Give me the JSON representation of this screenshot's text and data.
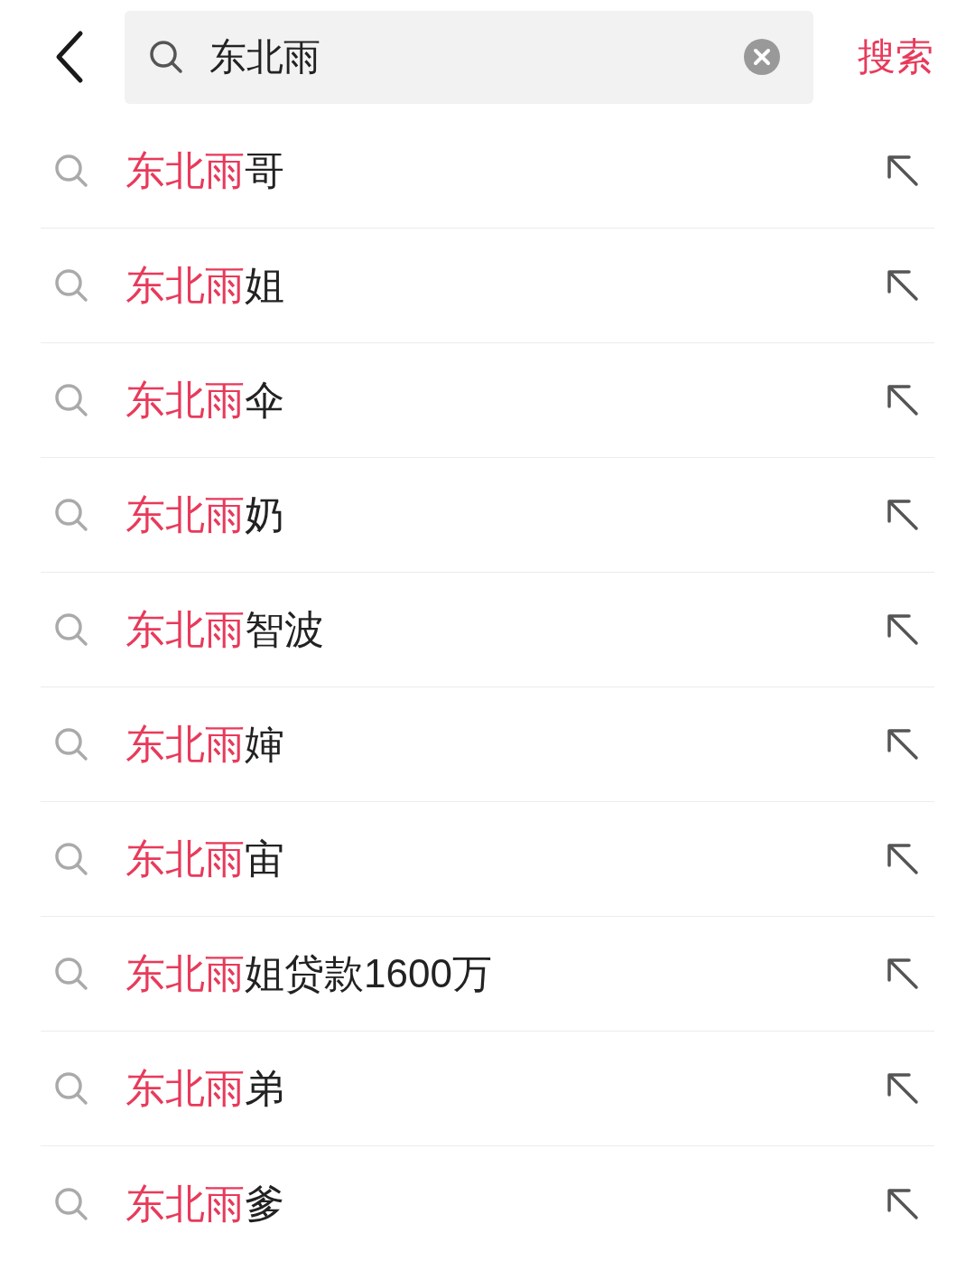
{
  "search": {
    "value": "东北雨",
    "button": "搜索"
  },
  "suggestions": [
    {
      "highlight": "东北雨",
      "rest": "哥"
    },
    {
      "highlight": "东北雨",
      "rest": "姐"
    },
    {
      "highlight": "东北雨",
      "rest": "伞"
    },
    {
      "highlight": "东北雨",
      "rest": "奶"
    },
    {
      "highlight": "东北雨",
      "rest": "智波"
    },
    {
      "highlight": "东北雨",
      "rest": "婶"
    },
    {
      "highlight": "东北雨",
      "rest": "宙"
    },
    {
      "highlight": "东北雨",
      "rest": "姐贷款1600万"
    },
    {
      "highlight": "东北雨",
      "rest": "弟"
    },
    {
      "highlight": "东北雨",
      "rest": "爹"
    }
  ]
}
